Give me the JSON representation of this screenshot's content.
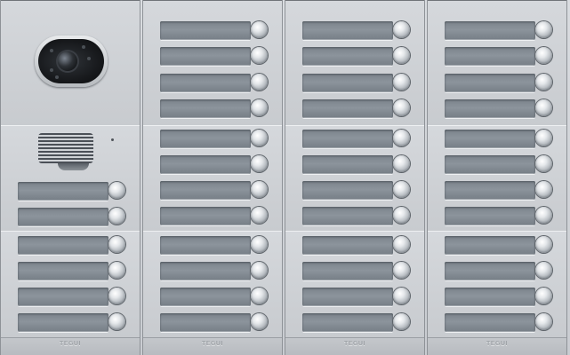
{
  "panel": {
    "columns": [
      {
        "modules": [
          "camera",
          "speaker",
          "buttons"
        ],
        "rows_top": [],
        "rows_mid": [
          0,
          1
        ],
        "rows_bot": [
          0,
          1,
          2,
          3
        ],
        "brand": "TEGUI"
      },
      {
        "modules": [
          "buttons",
          "buttons",
          "buttons"
        ],
        "rows_top": [
          0,
          1,
          2,
          3
        ],
        "rows_mid": [
          0,
          1,
          2,
          3
        ],
        "rows_bot": [
          0,
          1,
          2,
          3
        ],
        "brand": "TEGUI"
      },
      {
        "modules": [
          "buttons",
          "buttons",
          "buttons"
        ],
        "rows_top": [
          0,
          1,
          2,
          3
        ],
        "rows_mid": [
          0,
          1,
          2,
          3
        ],
        "rows_bot": [
          0,
          1,
          2,
          3
        ],
        "brand": "TEGUI"
      },
      {
        "modules": [
          "buttons",
          "buttons",
          "buttons"
        ],
        "rows_top": [
          0,
          1,
          2,
          3
        ],
        "rows_mid": [
          0,
          1,
          2,
          3
        ],
        "rows_bot": [
          0,
          1,
          2,
          3
        ],
        "brand": "TEGUI"
      }
    ],
    "icons": {
      "camera": "camera-icon",
      "speaker": "speaker-icon",
      "call_button": "call-button-icon"
    }
  }
}
